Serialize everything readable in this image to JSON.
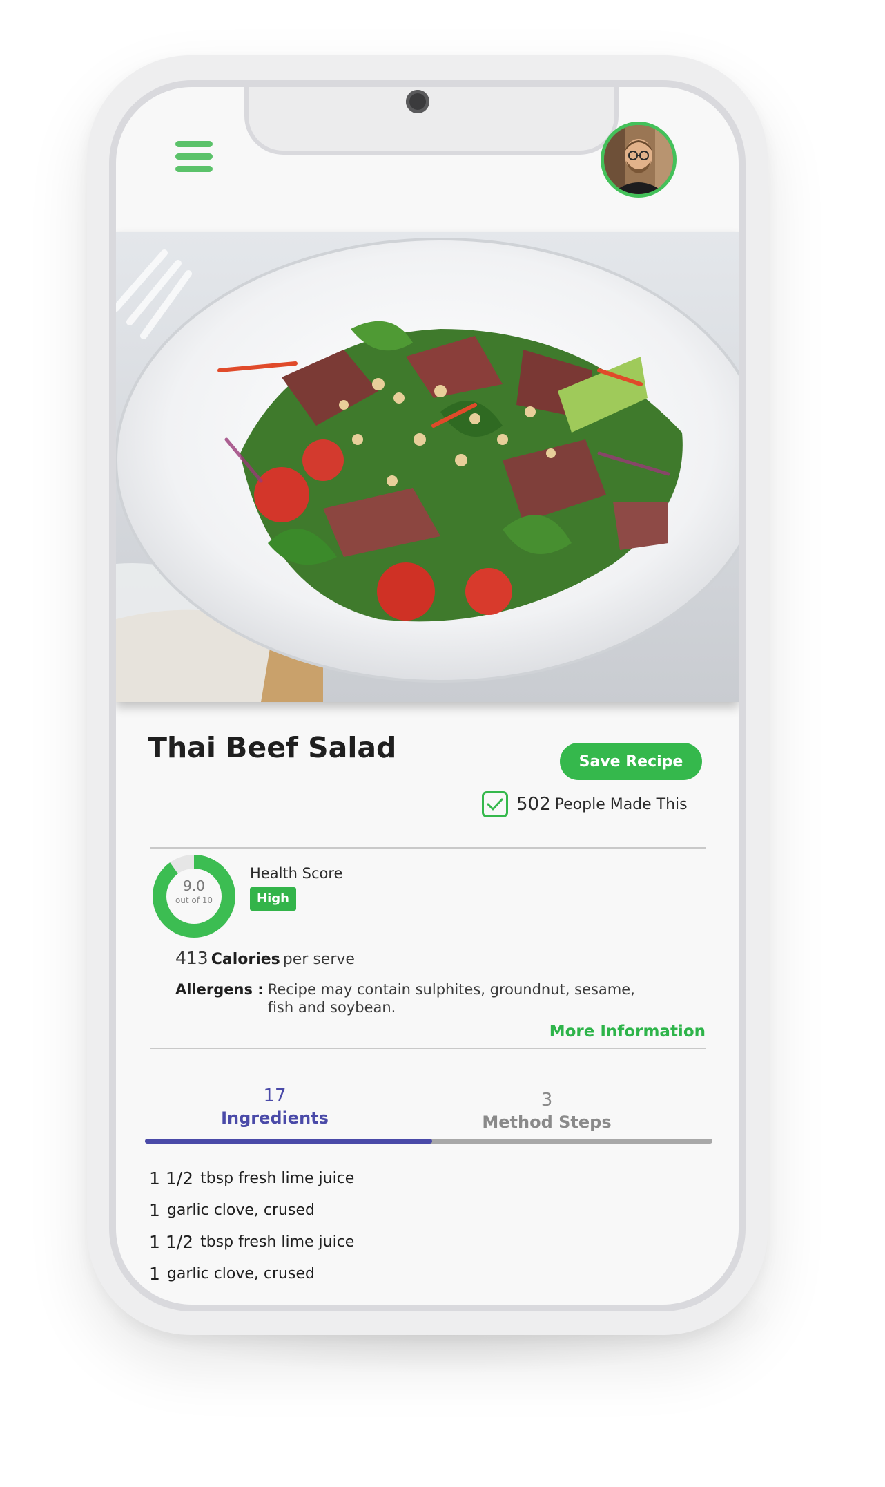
{
  "recipe": {
    "title": "Thai Beef Salad",
    "save_label": "Save Recipe",
    "made_count": "502",
    "made_label": "People Made This"
  },
  "health": {
    "score": 9.0,
    "score_text": "9.0",
    "score_sub": "out of 10",
    "label": "Health Score",
    "badge": "High"
  },
  "nutrition": {
    "calories_value": "413",
    "calories_label": "Calories",
    "calories_suffix": "per serve",
    "allergens_label": "Allergens :",
    "allergens_text": "Recipe may contain sulphites, groundnut, sesame, fish and soybean.",
    "more_info_label": "More Information"
  },
  "tabs": [
    {
      "count": "17",
      "label": "Ingredients",
      "active": true
    },
    {
      "count": "3",
      "label": "Method Steps",
      "active": false
    }
  ],
  "ingredients": [
    {
      "qty": "1 1/2",
      "text": "tbsp fresh lime juice"
    },
    {
      "qty": "1",
      "text": "garlic clove, crused"
    },
    {
      "qty": "1 1/2",
      "text": "tbsp fresh lime juice"
    },
    {
      "qty": "1",
      "text": "garlic clove, crused"
    }
  ],
  "icons": {
    "menu": "hamburger-menu-icon",
    "avatar": "user-avatar",
    "made": "checkbox-checked-icon"
  },
  "colors": {
    "accent_green": "#35b84c",
    "tab_active": "#4a4aa8",
    "tab_inactive": "#8a8a8a"
  }
}
